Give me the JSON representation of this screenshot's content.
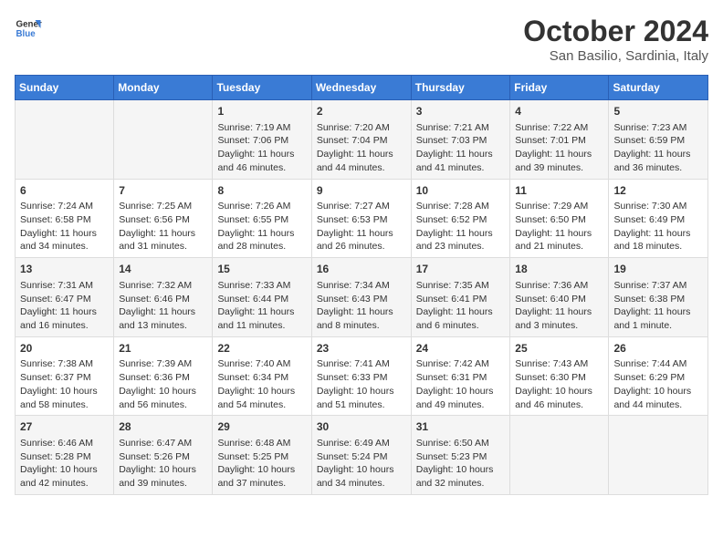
{
  "header": {
    "logo_line1": "General",
    "logo_line2": "Blue",
    "month": "October 2024",
    "location": "San Basilio, Sardinia, Italy"
  },
  "days_of_week": [
    "Sunday",
    "Monday",
    "Tuesday",
    "Wednesday",
    "Thursday",
    "Friday",
    "Saturday"
  ],
  "weeks": [
    [
      {
        "day": "",
        "content": ""
      },
      {
        "day": "",
        "content": ""
      },
      {
        "day": "1",
        "content": "Sunrise: 7:19 AM\nSunset: 7:06 PM\nDaylight: 11 hours and 46 minutes."
      },
      {
        "day": "2",
        "content": "Sunrise: 7:20 AM\nSunset: 7:04 PM\nDaylight: 11 hours and 44 minutes."
      },
      {
        "day": "3",
        "content": "Sunrise: 7:21 AM\nSunset: 7:03 PM\nDaylight: 11 hours and 41 minutes."
      },
      {
        "day": "4",
        "content": "Sunrise: 7:22 AM\nSunset: 7:01 PM\nDaylight: 11 hours and 39 minutes."
      },
      {
        "day": "5",
        "content": "Sunrise: 7:23 AM\nSunset: 6:59 PM\nDaylight: 11 hours and 36 minutes."
      }
    ],
    [
      {
        "day": "6",
        "content": "Sunrise: 7:24 AM\nSunset: 6:58 PM\nDaylight: 11 hours and 34 minutes."
      },
      {
        "day": "7",
        "content": "Sunrise: 7:25 AM\nSunset: 6:56 PM\nDaylight: 11 hours and 31 minutes."
      },
      {
        "day": "8",
        "content": "Sunrise: 7:26 AM\nSunset: 6:55 PM\nDaylight: 11 hours and 28 minutes."
      },
      {
        "day": "9",
        "content": "Sunrise: 7:27 AM\nSunset: 6:53 PM\nDaylight: 11 hours and 26 minutes."
      },
      {
        "day": "10",
        "content": "Sunrise: 7:28 AM\nSunset: 6:52 PM\nDaylight: 11 hours and 23 minutes."
      },
      {
        "day": "11",
        "content": "Sunrise: 7:29 AM\nSunset: 6:50 PM\nDaylight: 11 hours and 21 minutes."
      },
      {
        "day": "12",
        "content": "Sunrise: 7:30 AM\nSunset: 6:49 PM\nDaylight: 11 hours and 18 minutes."
      }
    ],
    [
      {
        "day": "13",
        "content": "Sunrise: 7:31 AM\nSunset: 6:47 PM\nDaylight: 11 hours and 16 minutes."
      },
      {
        "day": "14",
        "content": "Sunrise: 7:32 AM\nSunset: 6:46 PM\nDaylight: 11 hours and 13 minutes."
      },
      {
        "day": "15",
        "content": "Sunrise: 7:33 AM\nSunset: 6:44 PM\nDaylight: 11 hours and 11 minutes."
      },
      {
        "day": "16",
        "content": "Sunrise: 7:34 AM\nSunset: 6:43 PM\nDaylight: 11 hours and 8 minutes."
      },
      {
        "day": "17",
        "content": "Sunrise: 7:35 AM\nSunset: 6:41 PM\nDaylight: 11 hours and 6 minutes."
      },
      {
        "day": "18",
        "content": "Sunrise: 7:36 AM\nSunset: 6:40 PM\nDaylight: 11 hours and 3 minutes."
      },
      {
        "day": "19",
        "content": "Sunrise: 7:37 AM\nSunset: 6:38 PM\nDaylight: 11 hours and 1 minute."
      }
    ],
    [
      {
        "day": "20",
        "content": "Sunrise: 7:38 AM\nSunset: 6:37 PM\nDaylight: 10 hours and 58 minutes."
      },
      {
        "day": "21",
        "content": "Sunrise: 7:39 AM\nSunset: 6:36 PM\nDaylight: 10 hours and 56 minutes."
      },
      {
        "day": "22",
        "content": "Sunrise: 7:40 AM\nSunset: 6:34 PM\nDaylight: 10 hours and 54 minutes."
      },
      {
        "day": "23",
        "content": "Sunrise: 7:41 AM\nSunset: 6:33 PM\nDaylight: 10 hours and 51 minutes."
      },
      {
        "day": "24",
        "content": "Sunrise: 7:42 AM\nSunset: 6:31 PM\nDaylight: 10 hours and 49 minutes."
      },
      {
        "day": "25",
        "content": "Sunrise: 7:43 AM\nSunset: 6:30 PM\nDaylight: 10 hours and 46 minutes."
      },
      {
        "day": "26",
        "content": "Sunrise: 7:44 AM\nSunset: 6:29 PM\nDaylight: 10 hours and 44 minutes."
      }
    ],
    [
      {
        "day": "27",
        "content": "Sunrise: 6:46 AM\nSunset: 5:28 PM\nDaylight: 10 hours and 42 minutes."
      },
      {
        "day": "28",
        "content": "Sunrise: 6:47 AM\nSunset: 5:26 PM\nDaylight: 10 hours and 39 minutes."
      },
      {
        "day": "29",
        "content": "Sunrise: 6:48 AM\nSunset: 5:25 PM\nDaylight: 10 hours and 37 minutes."
      },
      {
        "day": "30",
        "content": "Sunrise: 6:49 AM\nSunset: 5:24 PM\nDaylight: 10 hours and 34 minutes."
      },
      {
        "day": "31",
        "content": "Sunrise: 6:50 AM\nSunset: 5:23 PM\nDaylight: 10 hours and 32 minutes."
      },
      {
        "day": "",
        "content": ""
      },
      {
        "day": "",
        "content": ""
      }
    ]
  ]
}
